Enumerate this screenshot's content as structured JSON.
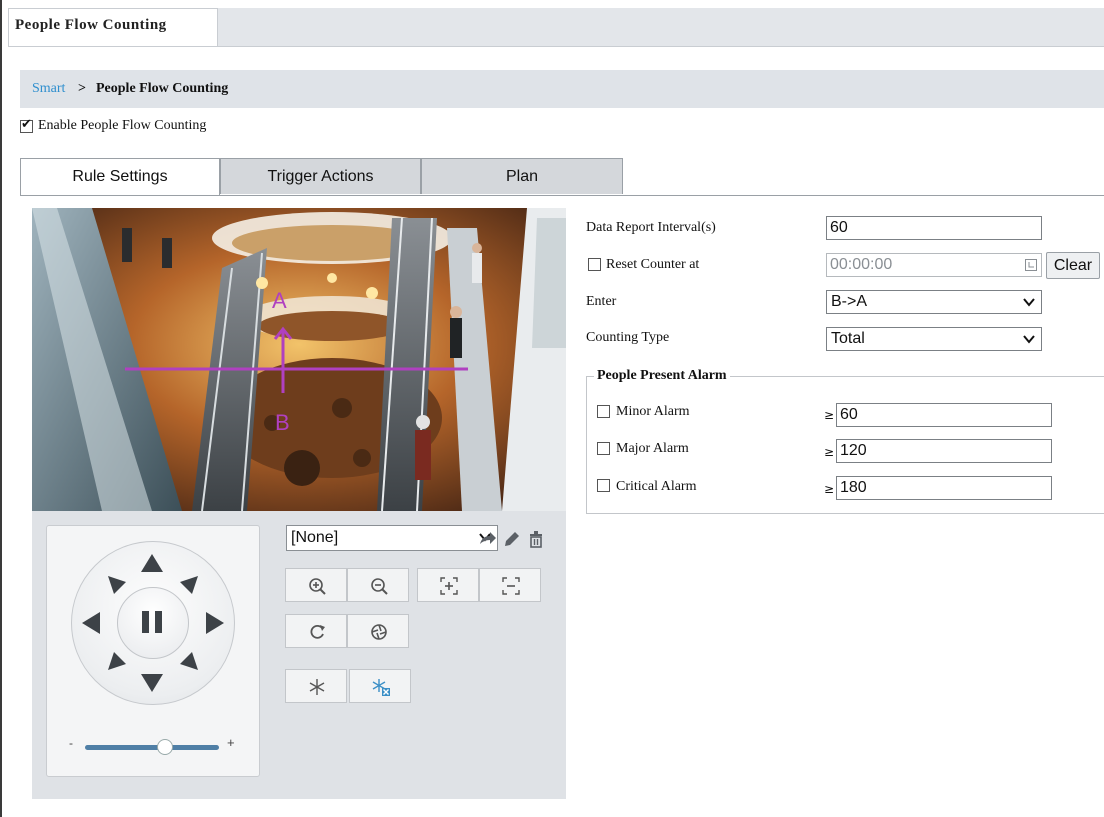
{
  "top_tab": {
    "label": "People Flow Counting"
  },
  "breadcrumb": {
    "link": "Smart",
    "separator": ">",
    "current": "People Flow Counting"
  },
  "enable": {
    "label": "Enable People Flow Counting",
    "checked": true
  },
  "tabs": [
    {
      "label": "Rule Settings",
      "active": true
    },
    {
      "label": "Trigger Actions",
      "active": false
    },
    {
      "label": "Plan",
      "active": false
    }
  ],
  "video": {
    "line_label_a": "A",
    "line_label_b": "B"
  },
  "ptz": {
    "preset_value": "[None]",
    "zoom_level": 0.6
  },
  "form": {
    "report_interval": {
      "label": "Data Report Interval(s)",
      "value": "60"
    },
    "reset_counter": {
      "label": "Reset Counter at",
      "value": "00:00:00",
      "clear_label": "Clear",
      "checked": false
    },
    "enter": {
      "label": "Enter",
      "value": "B->A"
    },
    "counting_type": {
      "label": "Counting Type",
      "value": "Total"
    }
  },
  "alarm": {
    "legend": "People Present Alarm",
    "symbol": "≥",
    "rows": [
      {
        "label": "Minor Alarm",
        "value": "60",
        "checked": false
      },
      {
        "label": "Major Alarm",
        "value": "120",
        "checked": false
      },
      {
        "label": "Critical Alarm",
        "value": "180",
        "checked": false
      }
    ]
  },
  "colors": {
    "link": "#2f8fce",
    "rule_line": "#b040c0",
    "slider": "#4f7fa6"
  }
}
